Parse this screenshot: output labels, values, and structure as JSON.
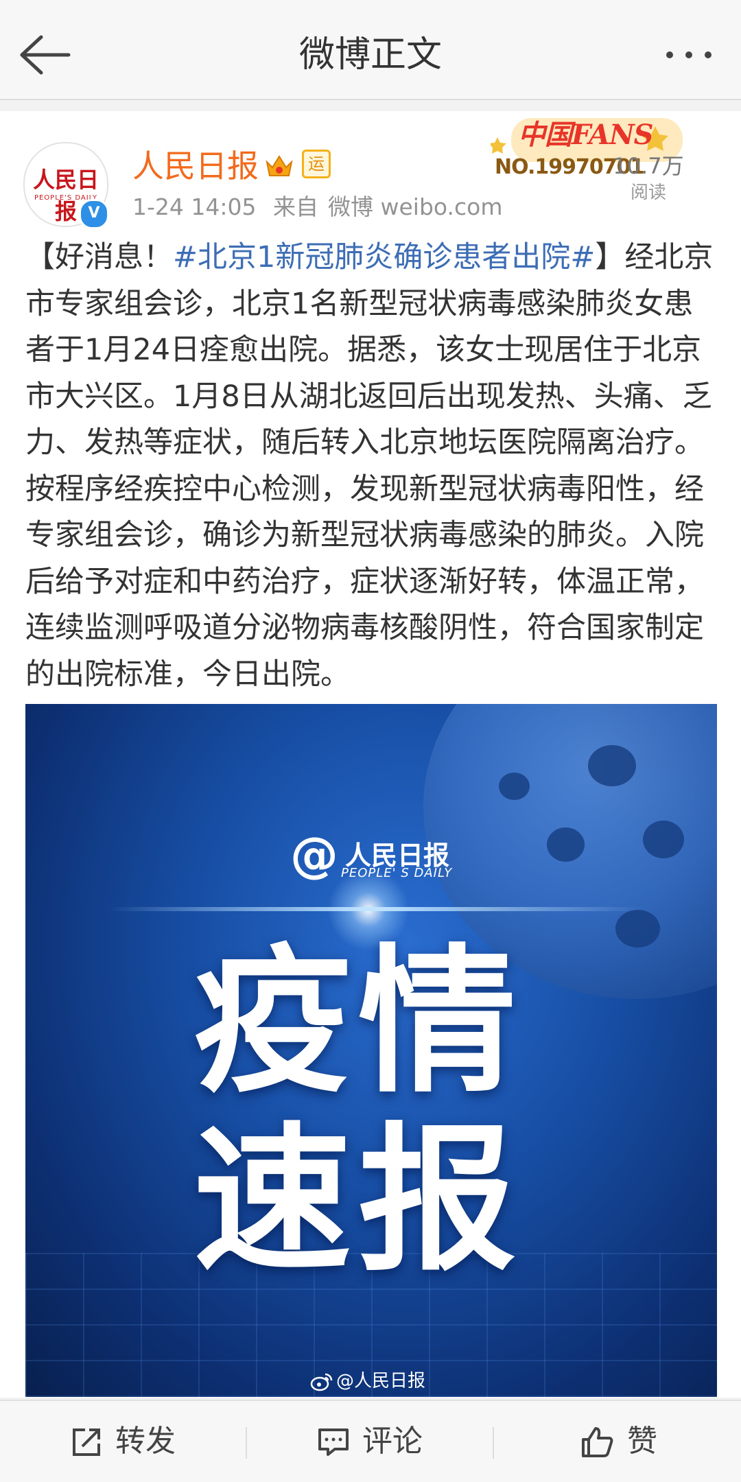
{
  "header": {
    "title": "微博正文"
  },
  "post": {
    "author": "人民日报",
    "avatar_logo": "人民日报",
    "avatar_sub": "PEOPLE'S DAILY",
    "yun_badge": "运",
    "time": "1-24 14:05",
    "source_prefix": "来自",
    "source": "微博 weibo.com",
    "fans_badge": {
      "title": "中国FANS",
      "number": "NO.19970701"
    },
    "read_count": "10.7万",
    "read_label": "阅读",
    "text_prefix": "【好消息！",
    "hashtag": "#北京1新冠肺炎确诊患者出院#",
    "text_body": "】经北京市专家组会诊，北京1名新型冠状病毒感染肺炎女患者于1月24日痊愈出院。据悉，该女士现居住于北京市大兴区。1月8日从湖北返回后出现发热、头痛、乏力、发热等症状，随后转入北京地坛医院隔离治疗。按程序经疾控中心检测，发现新型冠状病毒阳性，经专家组会诊，确诊为新型冠状病毒感染的肺炎。入院后给予对症和中药治疗，症状逐渐好转，体温正常，连续监测呼吸道分泌物病毒核酸阴性，符合国家制定的出院标准，今日出院。",
    "image": {
      "logo_at": "@",
      "logo_name": "人民日报",
      "logo_sub": "PEOPLE' S DAILY",
      "big_line1": "疫情",
      "big_line2": "速报",
      "watermark": "@人民日报"
    }
  },
  "actions": {
    "repost": "转发",
    "comment": "评论",
    "like": "赞"
  },
  "colors": {
    "author": "#f26a1b",
    "hashtag": "#3d6db5",
    "verified": "#2e8fe6"
  }
}
